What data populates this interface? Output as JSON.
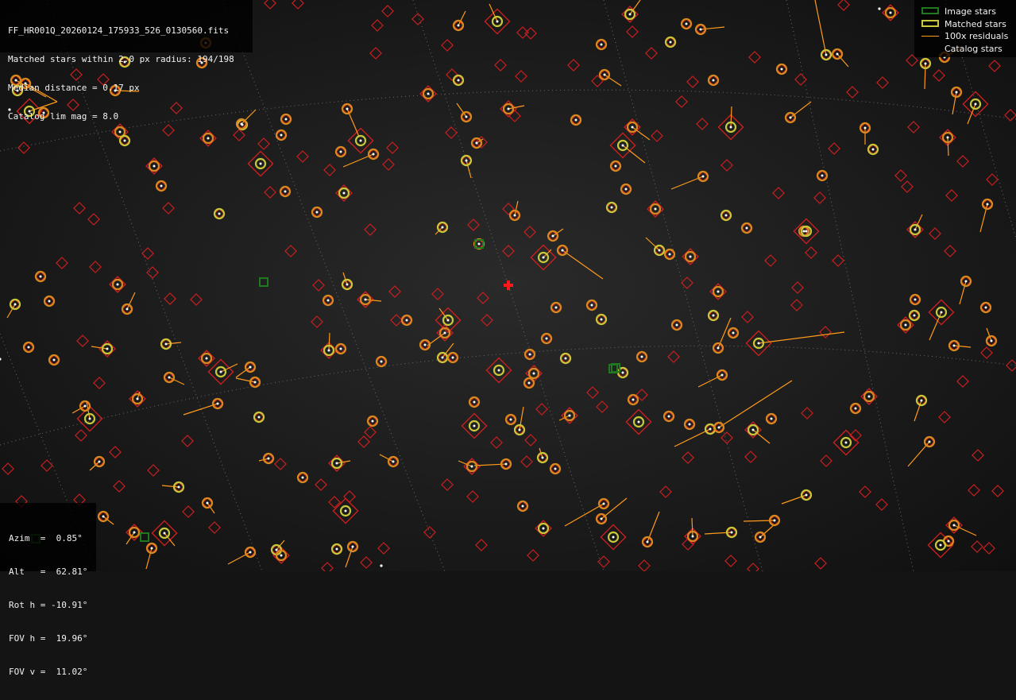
{
  "header": {
    "filename": "FF_HR001Q_20260124_175933_526_0130560.fits",
    "matched_line": "Matched stars within 2.0 px radius: 194/198",
    "median_line": "Median distance = 0.17 px",
    "catalog_line": "Catalog lim mag = 8.0"
  },
  "legend": {
    "items": [
      {
        "label": "Image stars",
        "kind": "box",
        "color": "#1f7a1f"
      },
      {
        "label": "Matched stars",
        "kind": "box",
        "color": "#c8c83a"
      },
      {
        "label": "100x residuals",
        "kind": "line",
        "color": "#ff9a1a"
      },
      {
        "label": "Catalog stars",
        "kind": "none",
        "color": "#cc1f1f"
      }
    ]
  },
  "pointing": {
    "azim": "Azim  =  0.85°",
    "alt": "Alt   =  62.81°",
    "rot": "Rot h = -10.91°",
    "fov_h": "FOV h =  19.96°",
    "fov_v": "FOV v =  11.02°"
  },
  "colors": {
    "catalog": "#cc1f1f",
    "matched": "#c8c83a",
    "residual": "#ff9a1a",
    "image_star": "#1f7a1f",
    "center": "#ff1a1a",
    "grid": "#6a6a6a"
  },
  "center_marker": "plus-icon"
}
